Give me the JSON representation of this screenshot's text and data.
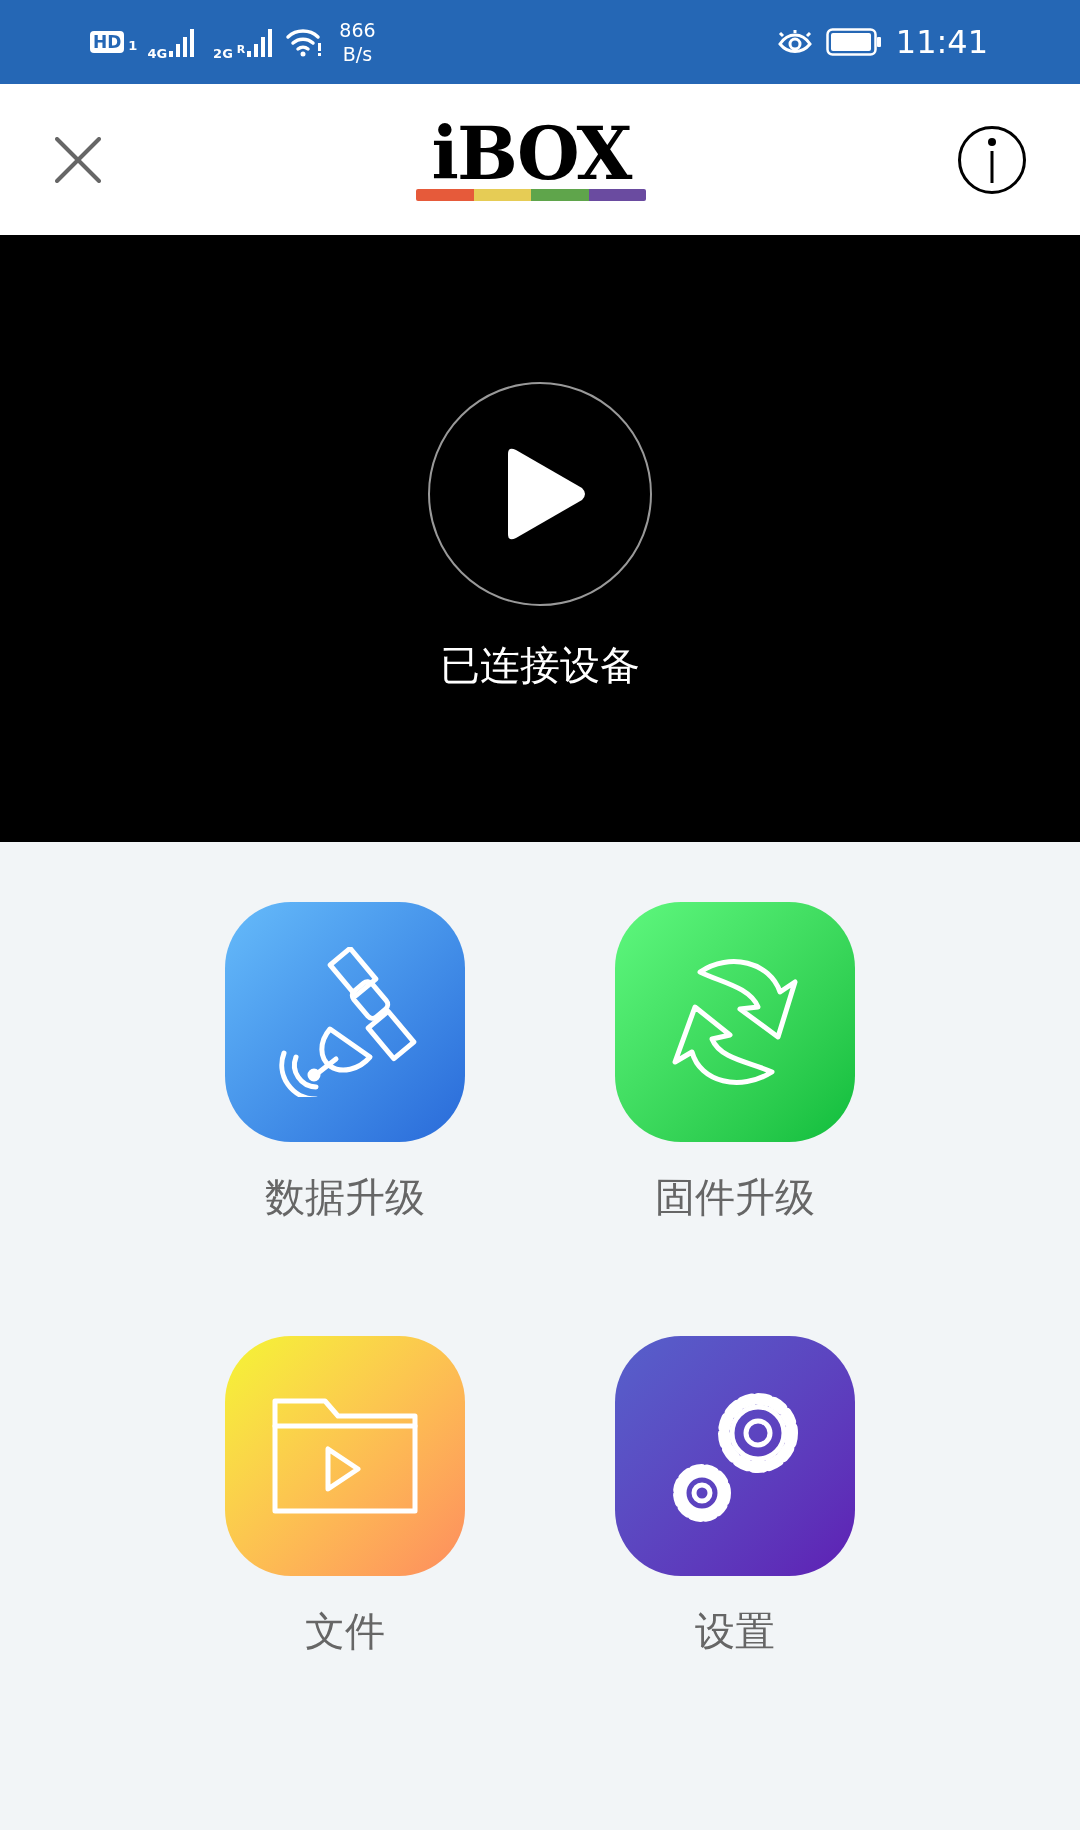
{
  "status_bar": {
    "hd": "HD",
    "sim": "1",
    "net1": "4G",
    "net2": "2G",
    "roaming": "R",
    "speed": "866",
    "speed_unit": "B/s",
    "time": "11:41"
  },
  "header": {
    "logo": "iBOX"
  },
  "player": {
    "status": "已连接设备"
  },
  "tiles": [
    {
      "kind": "satellite",
      "label": "数据升级"
    },
    {
      "kind": "sync",
      "label": "固件升级"
    },
    {
      "kind": "folder",
      "label": "文件"
    },
    {
      "kind": "settings",
      "label": "设置"
    }
  ]
}
